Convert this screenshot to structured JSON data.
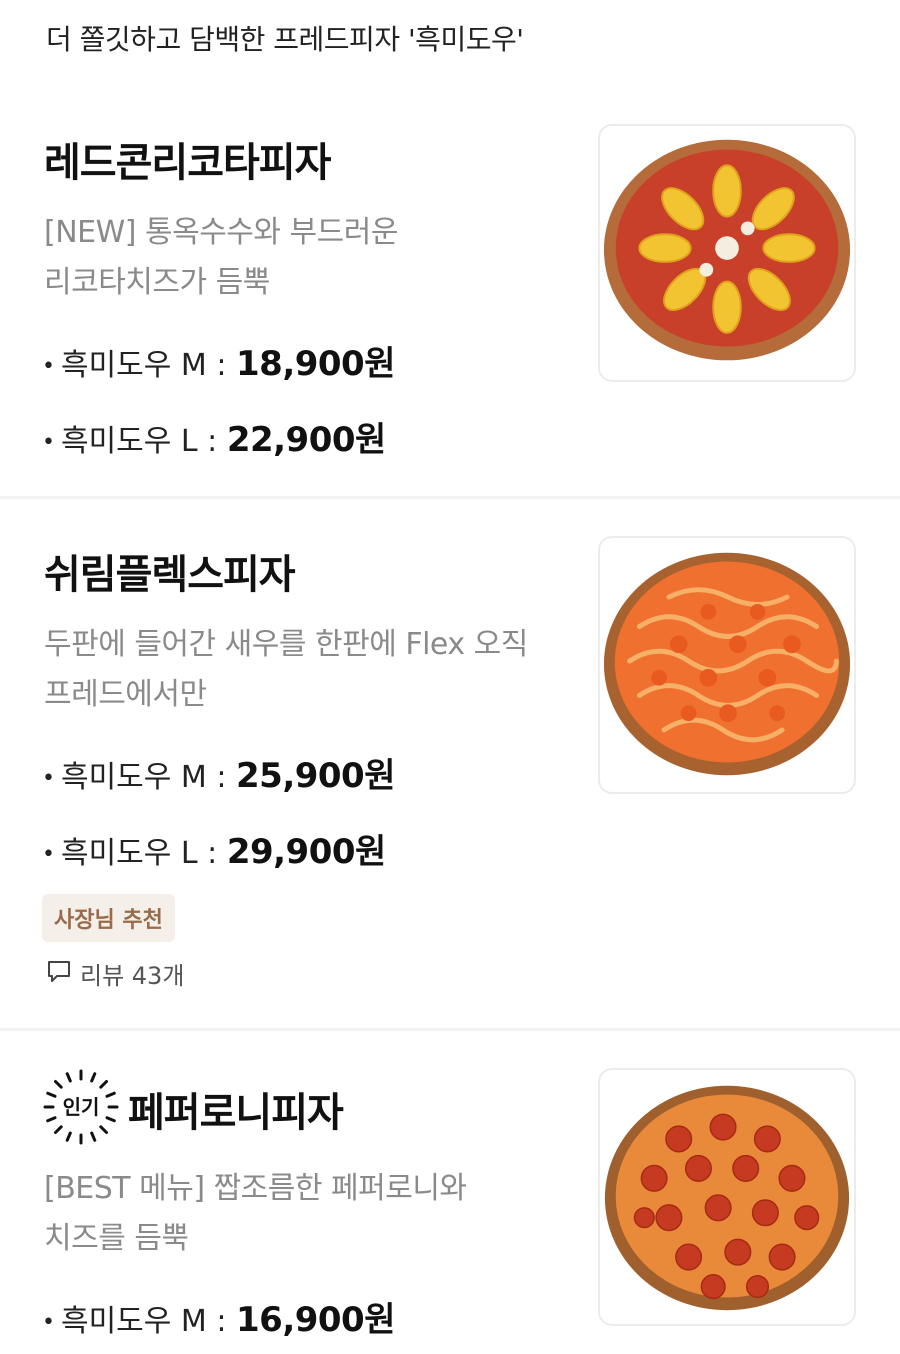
{
  "intro": "더 쫄깃하고 담백한 프레드피자 '흑미도우'",
  "items": [
    {
      "title": "레드콘리코타피자",
      "desc_line1": "[NEW] 통옥수수와 부드러운",
      "desc_line2": "리코타치즈가 듬뿍",
      "price_m_label": "흑미도우 M :",
      "price_m": "18,900원",
      "price_l_label": "흑미도우 L :",
      "price_l": "22,900원",
      "image_icon": "pizza-corn-ricotta-image"
    },
    {
      "title": "쉬림플렉스피자",
      "desc_line1": "두판에 들어간 새우를 한판에 Flex 오직",
      "desc_line2": "프레드에서만",
      "price_m_label": "흑미도우 M :",
      "price_m": "25,900원",
      "price_l_label": "흑미도우 L :",
      "price_l": "29,900원",
      "badge": "사장님 추천",
      "review": "리뷰 43개",
      "image_icon": "pizza-shrimp-image"
    },
    {
      "title": "페퍼로니피자",
      "popular_label": "인기",
      "desc_line1": "[BEST 메뉴] 짭조름한 페퍼로니와",
      "desc_line2": "치즈를 듬뿍",
      "price_m_label": "흑미도우 M :",
      "price_m": "16,900원",
      "image_icon": "pizza-pepperoni-image"
    }
  ],
  "colors": {
    "badge_bg": "#f5efe9",
    "badge_text": "#9a6b4b",
    "desc_text": "#8a8a8a"
  }
}
